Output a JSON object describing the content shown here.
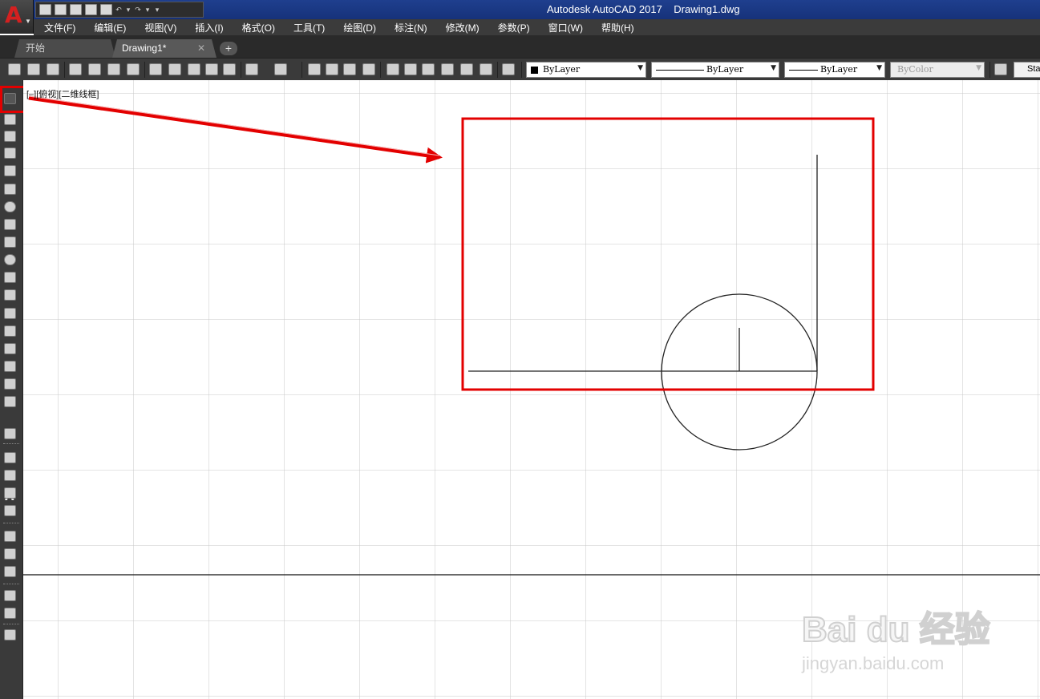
{
  "app": {
    "logo": "A",
    "title": "Autodesk AutoCAD 2017    Drawing1.dwg"
  },
  "menu": [
    {
      "label": "文件(F)"
    },
    {
      "label": "编辑(E)"
    },
    {
      "label": "视图(V)"
    },
    {
      "label": "插入(I)"
    },
    {
      "label": "格式(O)"
    },
    {
      "label": "工具(T)"
    },
    {
      "label": "绘图(D)"
    },
    {
      "label": "标注(N)"
    },
    {
      "label": "修改(M)"
    },
    {
      "label": "参数(P)"
    },
    {
      "label": "窗口(W)"
    },
    {
      "label": "帮助(H)"
    }
  ],
  "tabs": {
    "start": "开始",
    "drawing": "Drawing1*",
    "close": "✕",
    "add": "+"
  },
  "properties": {
    "color": "ByLayer",
    "linetype": "ByLayer",
    "lineweight": "ByLayer",
    "plotstyle": "ByColor",
    "textstyle": "Sta"
  },
  "viewport_label": "[–][俯视][二维线框]",
  "palette": {
    "text_tool": "A"
  },
  "colors": {
    "highlight": "#e30000",
    "titlebar": "#1f3f8e",
    "menubar": "#3b3b3b",
    "grid": "#c8c8c8"
  },
  "watermark": {
    "brand": "Bai du 经验",
    "url": "jingyan.baidu.com"
  }
}
